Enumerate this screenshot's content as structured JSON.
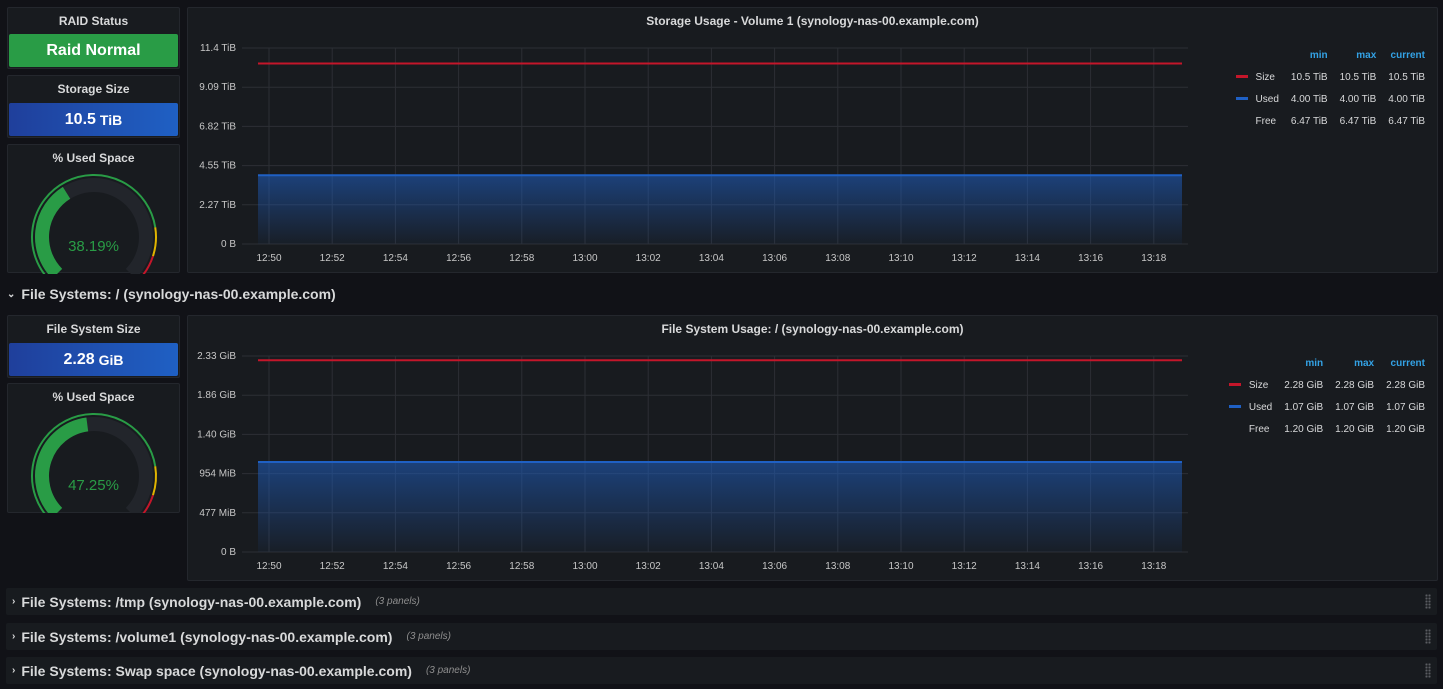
{
  "colors": {
    "green": "#299c46",
    "blue": "#1f60c4",
    "size_line": "#c4162a",
    "used_line": "#1f60c4",
    "legend_header": "#33a2e5"
  },
  "raid": {
    "title": "RAID Status",
    "value": "Raid Normal"
  },
  "storage_size": {
    "title": "Storage Size",
    "value": "10.5",
    "unit": "TiB"
  },
  "used_space_1": {
    "title": "% Used Space",
    "value": "38.19%",
    "fraction": 0.3819
  },
  "storage_chart": {
    "title": "Storage Usage - Volume 1 (synology-nas-00.example.com)",
    "yticks": [
      "11.4 TiB",
      "9.09 TiB",
      "6.82 TiB",
      "4.55 TiB",
      "2.27 TiB",
      "0 B"
    ],
    "legend": {
      "headers": [
        "min",
        "max",
        "current"
      ],
      "rows": [
        {
          "name": "Size",
          "min": "10.5 TiB",
          "max": "10.5 TiB",
          "current": "10.5 TiB",
          "color": "#c4162a"
        },
        {
          "name": "Used",
          "min": "4.00 TiB",
          "max": "4.00 TiB",
          "current": "4.00 TiB",
          "color": "#1f60c4"
        },
        {
          "name": "Free",
          "min": "6.47 TiB",
          "max": "6.47 TiB",
          "current": "6.47 TiB",
          "color": ""
        }
      ]
    }
  },
  "fs_root_row": {
    "label": "File Systems: / (synology-nas-00.example.com)"
  },
  "fs_size": {
    "title": "File System Size",
    "value": "2.28",
    "unit": "GiB"
  },
  "used_space_2": {
    "title": "% Used Space",
    "value": "47.25%",
    "fraction": 0.4725
  },
  "fs_chart": {
    "title": "File System Usage: / (synology-nas-00.example.com)",
    "yticks": [
      "2.33 GiB",
      "1.86 GiB",
      "1.40 GiB",
      "954 MiB",
      "477 MiB",
      "0 B"
    ],
    "legend": {
      "headers": [
        "min",
        "max",
        "current"
      ],
      "rows": [
        {
          "name": "Size",
          "min": "2.28 GiB",
          "max": "2.28 GiB",
          "current": "2.28 GiB",
          "color": "#c4162a"
        },
        {
          "name": "Used",
          "min": "1.07 GiB",
          "max": "1.07 GiB",
          "current": "1.07 GiB",
          "color": "#1f60c4"
        },
        {
          "name": "Free",
          "min": "1.20 GiB",
          "max": "1.20 GiB",
          "current": "1.20 GiB",
          "color": ""
        }
      ]
    }
  },
  "xticks": [
    "12:50",
    "12:52",
    "12:54",
    "12:56",
    "12:58",
    "13:00",
    "13:02",
    "13:04",
    "13:06",
    "13:08",
    "13:10",
    "13:12",
    "13:14",
    "13:16",
    "13:18"
  ],
  "collapsed_rows": [
    {
      "label": "File Systems: /tmp (synology-nas-00.example.com)",
      "count": "(3 panels)"
    },
    {
      "label": "File Systems: /volume1 (synology-nas-00.example.com)",
      "count": "(3 panels)"
    },
    {
      "label": "File Systems: Swap space (synology-nas-00.example.com)",
      "count": "(3 panels)"
    }
  ],
  "chart_data": [
    {
      "type": "area",
      "title": "Storage Usage - Volume 1 (synology-nas-00.example.com)",
      "x": [
        "12:50",
        "12:52",
        "12:54",
        "12:56",
        "12:58",
        "13:00",
        "13:02",
        "13:04",
        "13:06",
        "13:08",
        "13:10",
        "13:12",
        "13:14",
        "13:16",
        "13:18"
      ],
      "ylim": [
        0,
        11.4
      ],
      "unit": "TiB",
      "series": [
        {
          "name": "Size",
          "value": 10.5
        },
        {
          "name": "Used",
          "value": 4.0
        },
        {
          "name": "Free",
          "value": 6.47
        }
      ]
    },
    {
      "type": "area",
      "title": "File System Usage: / (synology-nas-00.example.com)",
      "x": [
        "12:50",
        "12:52",
        "12:54",
        "12:56",
        "12:58",
        "13:00",
        "13:02",
        "13:04",
        "13:06",
        "13:08",
        "13:10",
        "13:12",
        "13:14",
        "13:16",
        "13:18"
      ],
      "ylim": [
        0,
        2.33
      ],
      "unit": "GiB",
      "series": [
        {
          "name": "Size",
          "value": 2.28
        },
        {
          "name": "Used",
          "value": 1.07
        },
        {
          "name": "Free",
          "value": 1.2
        }
      ]
    }
  ]
}
